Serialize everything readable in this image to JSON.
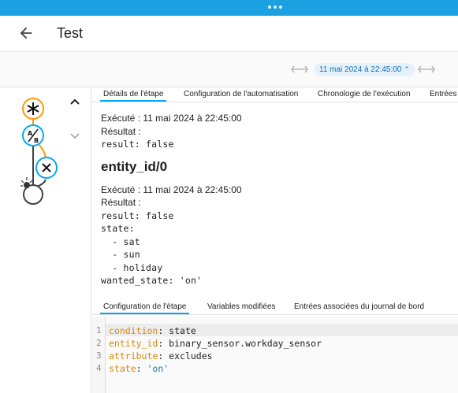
{
  "header": {
    "title": "Test"
  },
  "toolbar": {
    "date": "11 mai 2024 à 22:45:00"
  },
  "tabs": [
    {
      "label": "Détails de l'étape"
    },
    {
      "label": "Configuration de l'automatisation"
    },
    {
      "label": "Chronologie de l'exécution"
    },
    {
      "label": "Entrées"
    }
  ],
  "trace": {
    "executed1": "Exécuté : 11 mai 2024 à 22:45:00",
    "result_label1": "Résultat :",
    "result1": "result: false",
    "entity_heading": "entity_id/0",
    "executed2": "Exécuté : 11 mai 2024 à 22:45:00",
    "result_label2": "Résultat :",
    "result2_lines": [
      "result: false",
      "state:",
      "  - sat",
      "  - sun",
      "  - holiday",
      "wanted_state: 'on'"
    ]
  },
  "subtabs": [
    {
      "label": "Configuration de l'étape"
    },
    {
      "label": "Variables modifiées"
    },
    {
      "label": "Entrées associées du journal de bord"
    }
  ],
  "code": {
    "line_numbers": [
      "1",
      "2",
      "3",
      "4"
    ],
    "lines": [
      {
        "key": "condition",
        "sep": ": ",
        "value": "state",
        "is_string": false
      },
      {
        "key": "entity_id",
        "sep": ": ",
        "value": "binary_sensor.workday_sensor",
        "is_string": false
      },
      {
        "key": "attribute",
        "sep": ": ",
        "value": "excludes",
        "is_string": false
      },
      {
        "key": "state",
        "sep": ": ",
        "value": "'on'",
        "is_string": true
      }
    ]
  },
  "graph": {
    "nodes": [
      "trigger-icon",
      "condition-ab-icon",
      "failed-x-icon",
      "action-light-icon"
    ],
    "colors": {
      "trigger": "#ff9800",
      "active": "#03a9f4",
      "inactive": "#424242"
    }
  }
}
